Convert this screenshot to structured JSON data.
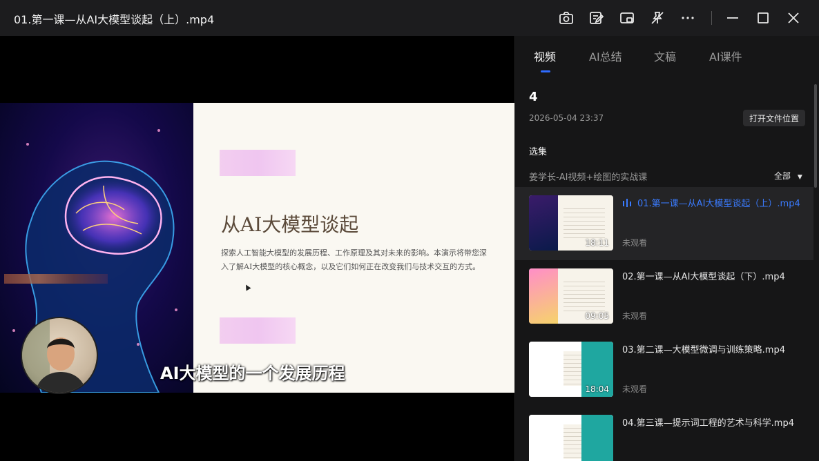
{
  "window": {
    "title": "01.第一课—从AI大模型谈起（上）.mp4",
    "icons": [
      "camera-icon",
      "edit-note-icon",
      "picture-in-picture-icon",
      "pin-off-icon",
      "more-icon",
      "minimize-icon",
      "maximize-icon",
      "close-icon"
    ]
  },
  "video": {
    "slide_title": "从AI大模型谈起",
    "slide_body": "探索人工智能大模型的发展历程、工作原理及其对未来的影响。本演示将带您深入了解AI大模型的核心概念，以及它们如何正在改变我们与技术交互的方式。",
    "subtitle": "AI大模型的一个发展历程"
  },
  "panel": {
    "tabs": [
      "视频",
      "AI总结",
      "文稿",
      "AI课件"
    ],
    "active_tab": "视频",
    "count": "4",
    "date": "2026-05-04 23:37",
    "open_location_label": "打开文件位置",
    "selection_label": "选集",
    "series_name": "姜学长-AI视频+绘图的实战课",
    "filter_label": "全部",
    "accent_color": "#3a7bff",
    "episodes": [
      {
        "title": "01.第一课—从AI大模型谈起（上）.mp4",
        "status": "未观看",
        "duration": "18:11",
        "active": true
      },
      {
        "title": "02.第一课—从AI大模型谈起（下）.mp4",
        "status": "未观看",
        "duration": "09:05",
        "active": false
      },
      {
        "title": "03.第二课—大模型微调与训练策略.mp4",
        "status": "未观看",
        "duration": "18:04",
        "active": false
      },
      {
        "title": "04.第三课—提示词工程的艺术与科学.mp4",
        "status": "",
        "duration": "",
        "active": false
      }
    ]
  }
}
